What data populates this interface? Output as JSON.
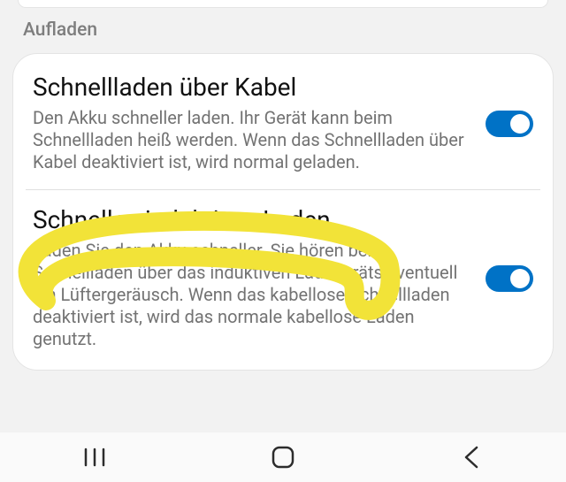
{
  "section_header": "Aufladen",
  "settings": [
    {
      "title": "Schnellladen über Kabel",
      "body": "Den Akku schneller laden. Ihr Gerät kann beim Schnellladen heiß werden. Wenn das Schnellladen über Kabel deaktiviert ist, wird normal geladen.",
      "enabled": true
    },
    {
      "title": "Schnelles induktives Laden",
      "body": "Laden Sie den Akku schneller. Sie hören beim Schnellladen über das induktiven Ladegeräts eventuell ein Lüftergeräusch. Wenn das kabellose Schnellladen deaktiviert ist, wird das normale kabellose Laden genutzt.",
      "enabled": true
    }
  ],
  "annotation": {
    "color": "#f2e338"
  },
  "nav": {
    "recent": "recent-apps",
    "home": "home",
    "back": "back"
  }
}
